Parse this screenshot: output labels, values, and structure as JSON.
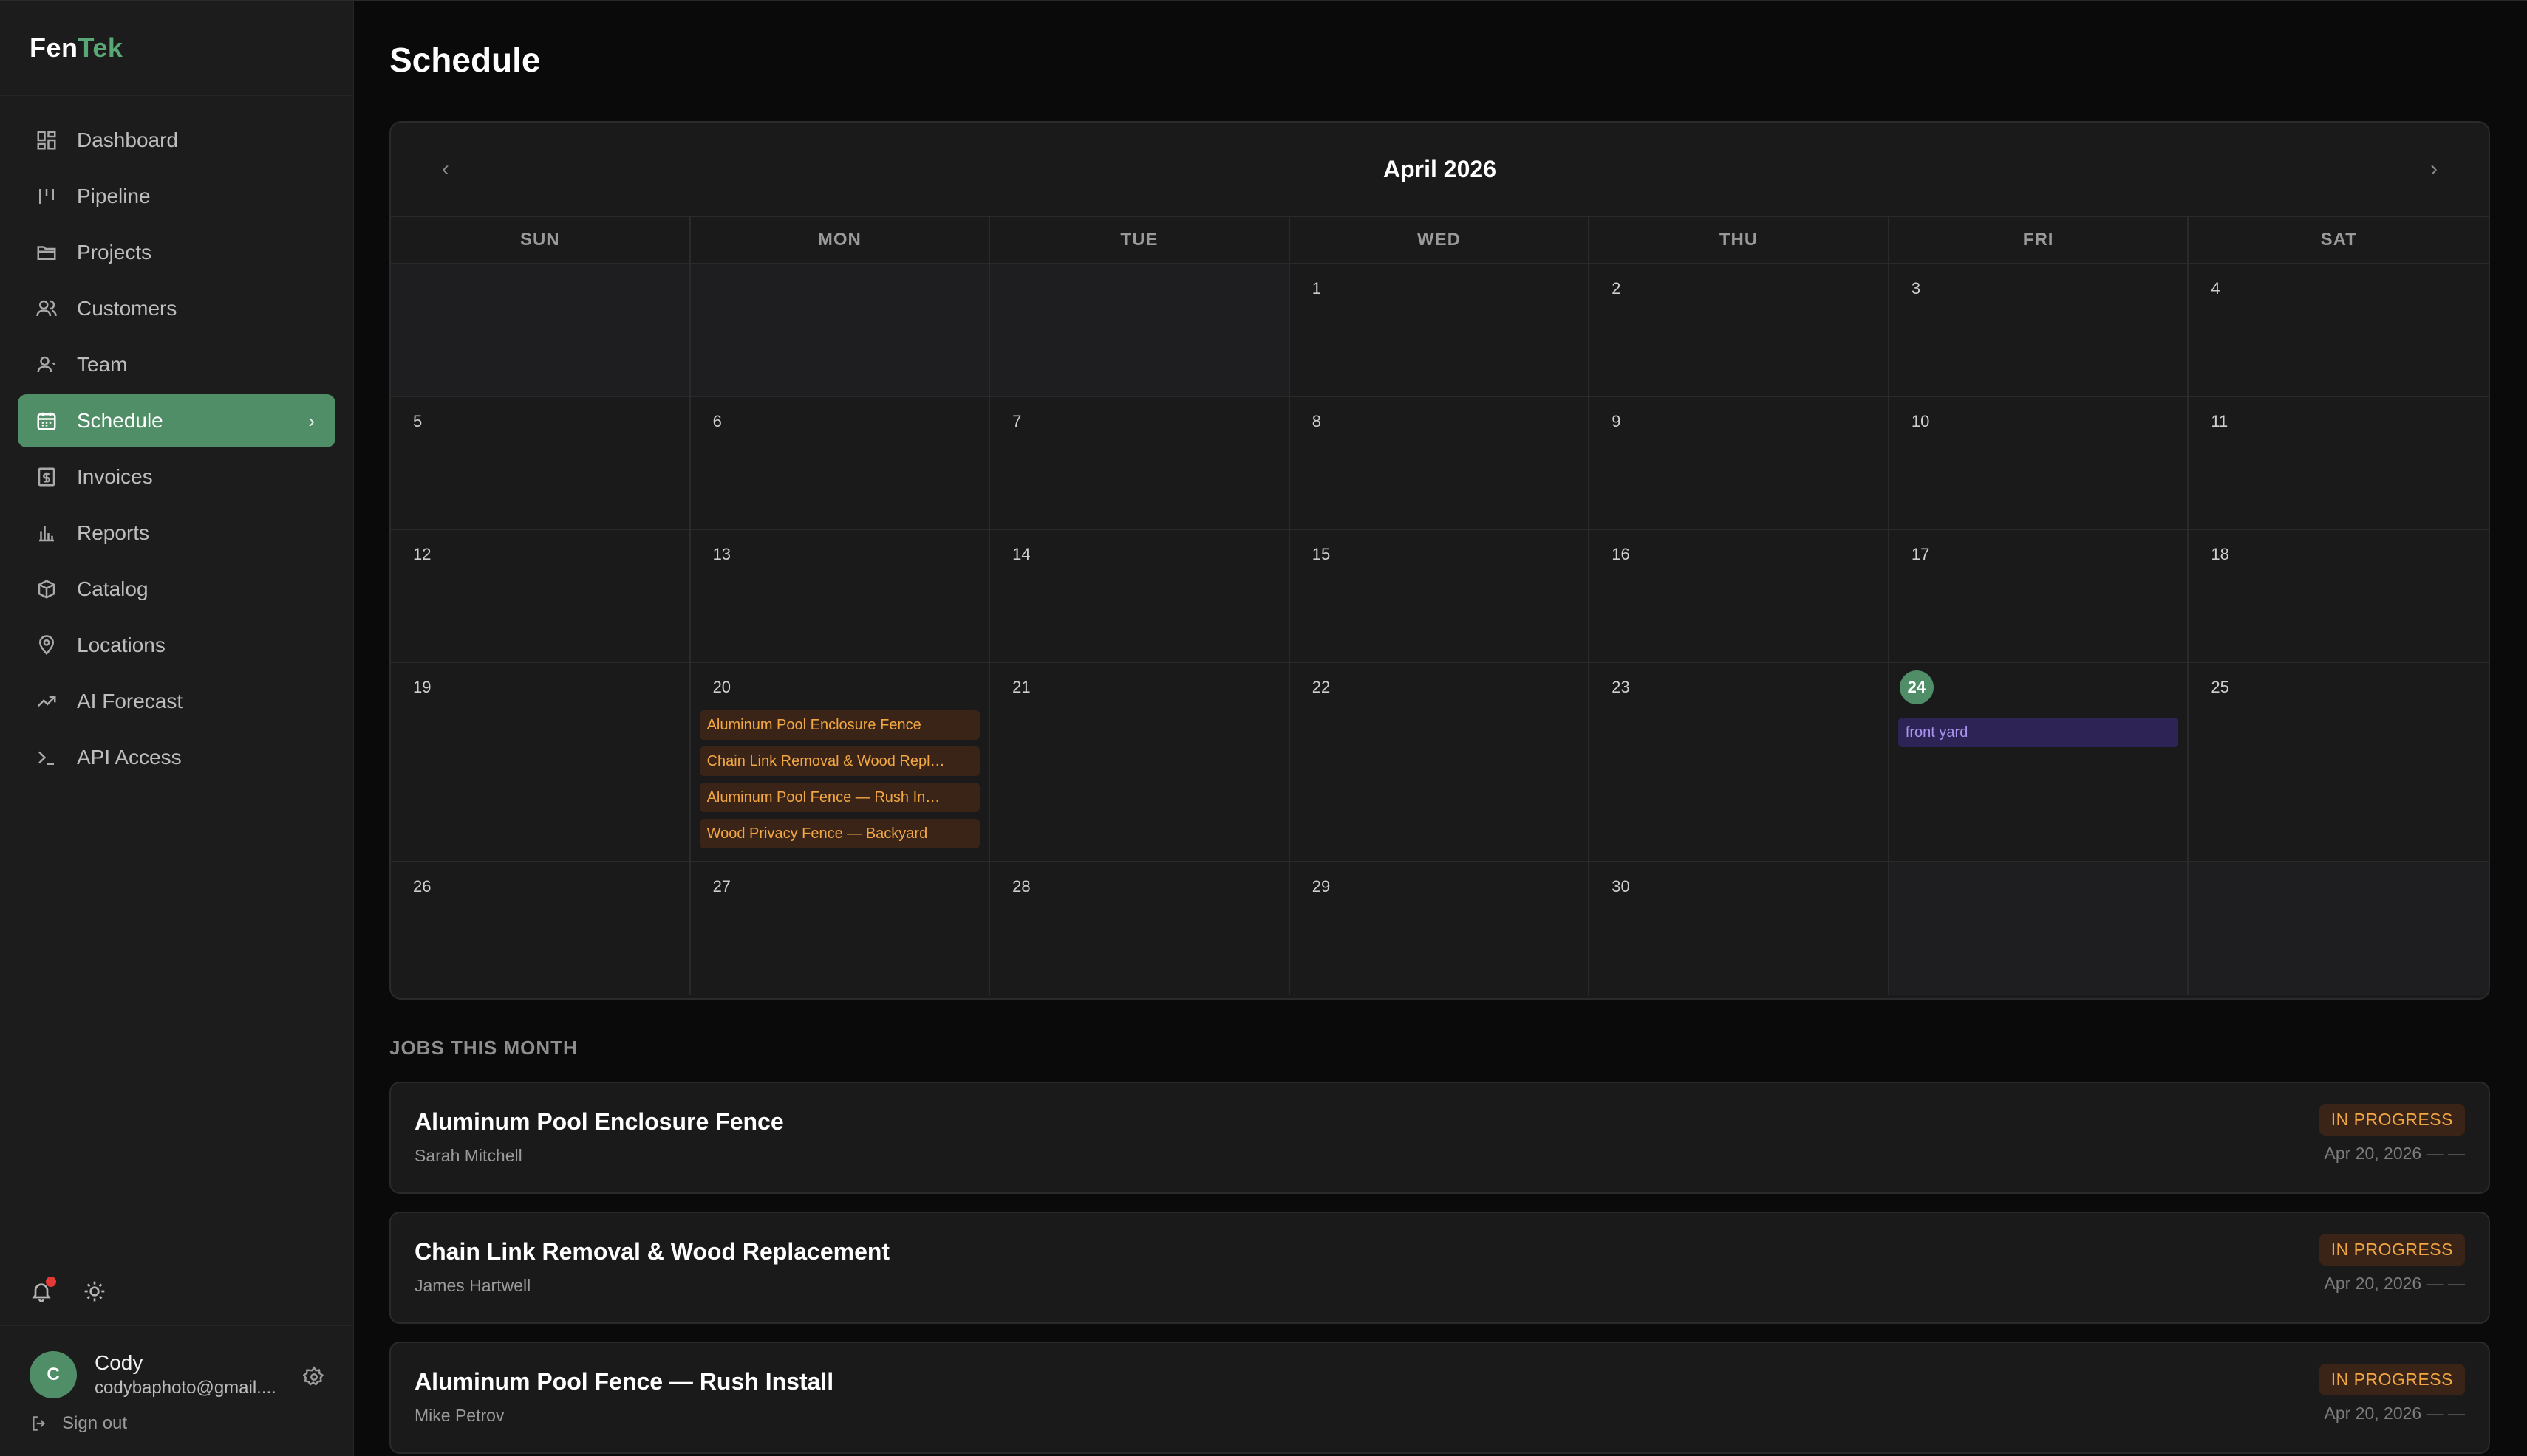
{
  "brand": {
    "part1": "Fen",
    "part2": "Tek",
    "accent": "#5aa776"
  },
  "sidebar": {
    "items": [
      {
        "label": "Dashboard",
        "icon": "dashboard-icon"
      },
      {
        "label": "Pipeline",
        "icon": "pipeline-icon"
      },
      {
        "label": "Projects",
        "icon": "folder-icon"
      },
      {
        "label": "Customers",
        "icon": "users-icon"
      },
      {
        "label": "Team",
        "icon": "team-icon"
      },
      {
        "label": "Schedule",
        "icon": "calendar-icon",
        "active": true
      },
      {
        "label": "Invoices",
        "icon": "invoice-icon"
      },
      {
        "label": "Reports",
        "icon": "bar-chart-icon"
      },
      {
        "label": "Catalog",
        "icon": "box-icon"
      },
      {
        "label": "Locations",
        "icon": "map-pin-icon"
      },
      {
        "label": "AI Forecast",
        "icon": "trend-icon"
      },
      {
        "label": "API Access",
        "icon": "terminal-icon"
      }
    ],
    "active_chevron": "›"
  },
  "user": {
    "initial": "C",
    "name": "Cody",
    "email": "codybaphoto@gmail...."
  },
  "signout_label": "Sign out",
  "page": {
    "title": "Schedule"
  },
  "calendar": {
    "month_label": "April 2026",
    "prev": "‹",
    "next": "›",
    "days_of_week": [
      "SUN",
      "MON",
      "TUE",
      "WED",
      "THU",
      "FRI",
      "SAT"
    ],
    "today": "24",
    "weeks": [
      [
        "",
        "",
        "",
        "1",
        "2",
        "3",
        "4"
      ],
      [
        "5",
        "6",
        "7",
        "8",
        "9",
        "10",
        "11"
      ],
      [
        "12",
        "13",
        "14",
        "15",
        "16",
        "17",
        "18"
      ],
      [
        "19",
        "20",
        "21",
        "22",
        "23",
        "24",
        "25"
      ],
      [
        "26",
        "27",
        "28",
        "29",
        "30",
        "",
        ""
      ]
    ],
    "events": {
      "20": [
        {
          "label": "Aluminum Pool Enclosure Fence",
          "color": "orange"
        },
        {
          "label": "Chain Link Removal & Wood Repl…",
          "color": "orange"
        },
        {
          "label": "Aluminum Pool Fence — Rush In…",
          "color": "orange"
        },
        {
          "label": "Wood Privacy Fence — Backyard",
          "color": "orange"
        }
      ],
      "24": [
        {
          "label": "front yard",
          "color": "purple"
        }
      ]
    }
  },
  "jobs": {
    "section_title": "JOBS THIS MONTH",
    "items": [
      {
        "title": "Aluminum Pool Enclosure Fence",
        "customer": "Sarah Mitchell",
        "status": "IN PROGRESS",
        "date": "Apr 20, 2026 — —"
      },
      {
        "title": "Chain Link Removal & Wood Replacement",
        "customer": "James Hartwell",
        "status": "IN PROGRESS",
        "date": "Apr 20, 2026 — —"
      },
      {
        "title": "Aluminum Pool Fence — Rush Install",
        "customer": "Mike Petrov",
        "status": "IN PROGRESS",
        "date": "Apr 20, 2026 — —"
      }
    ]
  }
}
